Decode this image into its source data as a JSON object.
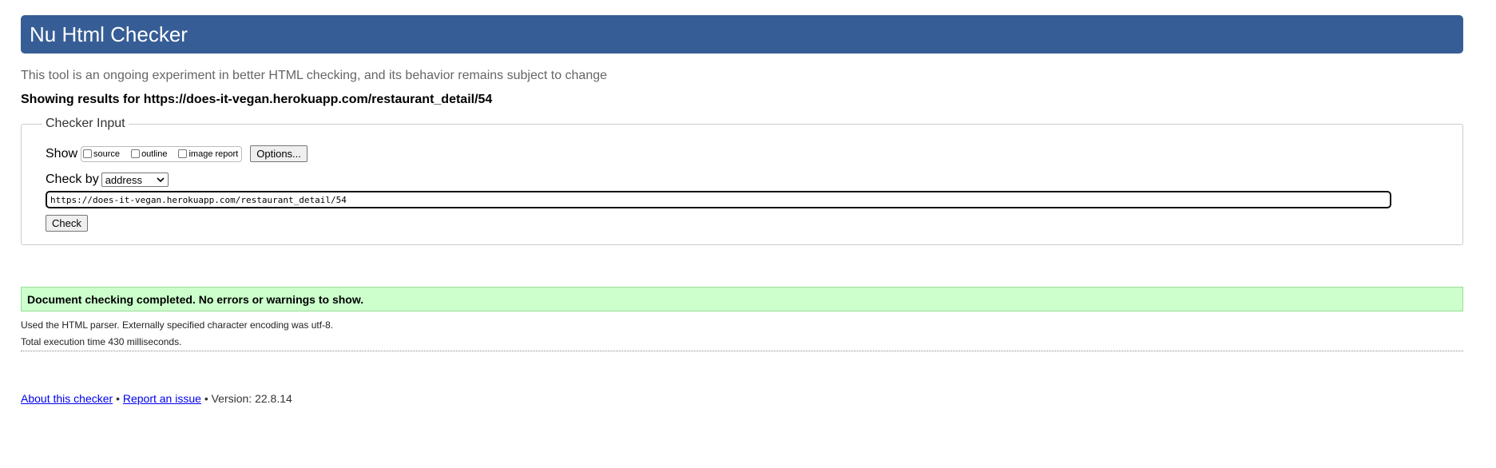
{
  "header": {
    "title": "Nu Html Checker"
  },
  "tagline": "This tool is an ongoing experiment in better HTML checking, and its behavior remains subject to change",
  "showing": "Showing results for https://does-it-vegan.herokuapp.com/restaurant_detail/54",
  "checker_input": {
    "legend": "Checker Input",
    "show_label": "Show",
    "options": [
      "source",
      "outline",
      "image report"
    ],
    "options_button": "Options...",
    "check_by_label": "Check by",
    "check_by_value": "address",
    "url_value": "https://does-it-vegan.herokuapp.com/restaurant_detail/54",
    "check_button": "Check"
  },
  "result": {
    "message": "Document checking completed. No errors or warnings to show.",
    "parser_note": "Used the HTML parser. Externally specified character encoding was utf-8.",
    "time_note": "Total execution time 430 milliseconds."
  },
  "footer": {
    "about_link": "About this checker",
    "sep1": "•",
    "issue_link": "Report an issue",
    "version": "• Version: 22.8.14"
  }
}
